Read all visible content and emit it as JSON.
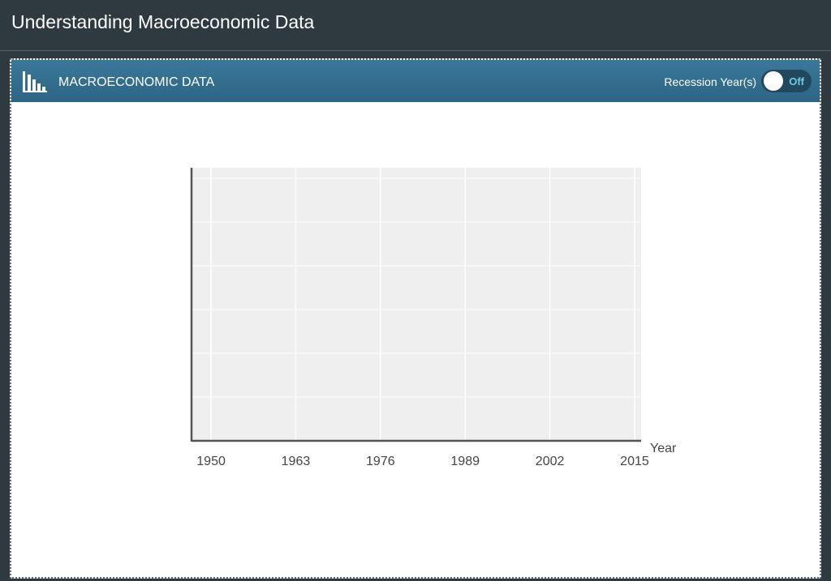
{
  "app": {
    "title": "Understanding Macroeconomic Data"
  },
  "panel": {
    "title": "MACROECONOMIC DATA",
    "icon": "bar-chart-icon",
    "recession_toggle": {
      "label": "Recession Year(s)",
      "state": "Off"
    }
  },
  "colors": {
    "header_bg": "#2e3a40",
    "panel_header_bg": "#2d6585",
    "plot_bg": "#efefef",
    "toggle_text": "#6ecbe8"
  },
  "chart_data": {
    "type": "line",
    "title": "",
    "xlabel": "Year",
    "ylabel": "",
    "x_ticks": [
      "1950",
      "1963",
      "1976",
      "1989",
      "2002",
      "2015"
    ],
    "xlim": [
      1947,
      2016
    ],
    "series": [],
    "grid": true
  }
}
